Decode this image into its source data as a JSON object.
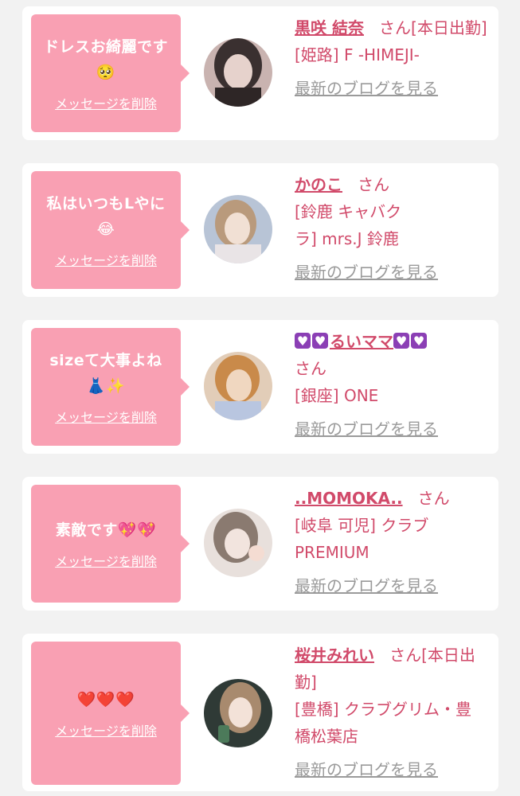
{
  "cards": [
    {
      "message_line1": "ドレスお綺麗です",
      "message_line2": "🥺",
      "delete_label": "メッセージを削除",
      "name": "黒咲 結奈",
      "suffix": "さん[本日出勤]",
      "shop": "[姫路] F -HIMEJI-",
      "blog_label": "最新のブログを見る",
      "avatar_colors": [
        "#3a3030",
        "#c9b3b0"
      ]
    },
    {
      "message_line1": "私はいつもLやに",
      "message_line2": "😂",
      "delete_label": "メッセージを削除",
      "name": "かのこ",
      "suffix": "さん",
      "shop": "[鈴鹿 キャバクラ] mrs.J 鈴鹿",
      "blog_label": "最新のブログを見る",
      "avatar_colors": [
        "#b8c4d6",
        "#e8d6c8"
      ]
    },
    {
      "message_line1": "sizeて大事よね",
      "message_line2": "👗✨",
      "delete_label": "メッセージを削除",
      "name": "るいママ",
      "suffix": "さん",
      "shop": "[銀座] ONE",
      "blog_label": "最新のブログを見る",
      "avatar_colors": [
        "#c98a4a",
        "#f0d7c0"
      ]
    },
    {
      "message_line1": "素敵です💖💖",
      "message_line2": "",
      "delete_label": "メッセージを削除",
      "name": "..MOMOKA..",
      "suffix": "さん",
      "shop": "[岐阜 可児] クラブPREMIUM",
      "blog_label": "最新のブログを見る",
      "avatar_colors": [
        "#8a7a70",
        "#e8e0dc"
      ]
    },
    {
      "message_line1": "❤️❤️❤️",
      "message_line2": "",
      "delete_label": "メッセージを削除",
      "name": "桜井みれい",
      "suffix": "さん[本日出勤]",
      "shop": "[豊橋] クラブグリム・豊橋松葉店",
      "blog_label": "最新のブログを見る",
      "avatar_colors": [
        "#2f3a36",
        "#d8c2b0"
      ]
    }
  ]
}
